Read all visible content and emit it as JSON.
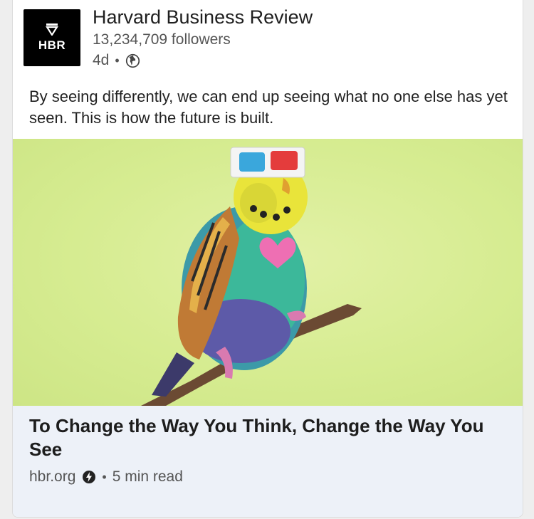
{
  "author": {
    "logo_text": "HBR",
    "name": "Harvard Business Review",
    "followers": "13,234,709 followers",
    "age": "4d",
    "separator": "•"
  },
  "post": {
    "text": "By seeing differently, we can end up seeing what no one else has yet seen. This is how the future is built."
  },
  "image": {
    "background_color": "#d6ec91"
  },
  "link": {
    "title": "To Change the Way You Think, Change the Way You See",
    "domain": "hbr.org",
    "separator": "•",
    "read_time": "5 min read"
  },
  "icons": {
    "logo_shield": "shield-icon",
    "visibility": "globe-icon",
    "amp": "lightning-icon"
  },
  "colors": {
    "card_bg": "#ffffff",
    "link_bg": "#edf1f8",
    "logo_bg": "#000000"
  }
}
